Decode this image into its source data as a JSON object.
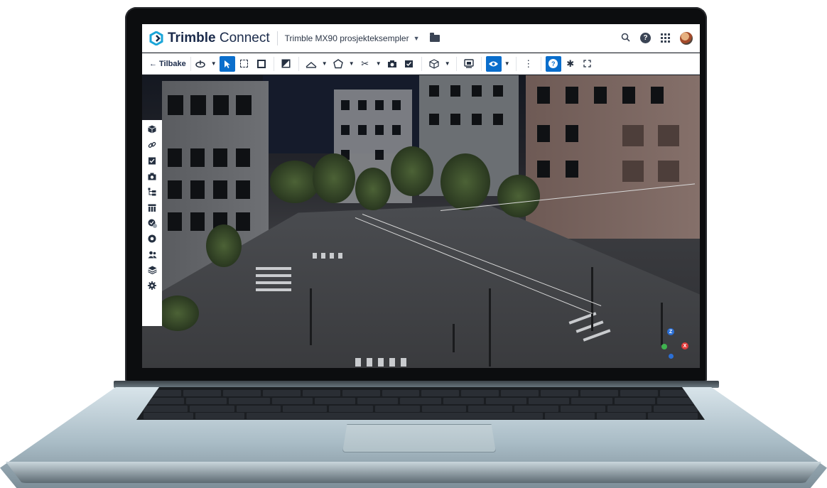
{
  "app": {
    "brand_bold": "Trimble",
    "brand_regular": "Connect",
    "project_name": "Trimble MX90 prosjekteksempler"
  },
  "toolbar": {
    "back_label": "Tilbake"
  },
  "gizmo": {
    "z_label": "Z",
    "x_label": "X"
  },
  "colors": {
    "accent": "#0a6ecc",
    "brand_icon": "#1aa5d8",
    "toolbar_text": "#253041"
  },
  "icons": {
    "topbar": [
      "search-icon",
      "help-icon",
      "apps-grid-icon",
      "avatar"
    ],
    "sidebar": [
      "cube-icon",
      "link-icon",
      "checklist-icon",
      "camera-icon",
      "tree-icon",
      "table-icon",
      "status-icon",
      "shape-icon",
      "users-icon",
      "layers-icon",
      "settings-gear-icon"
    ]
  }
}
